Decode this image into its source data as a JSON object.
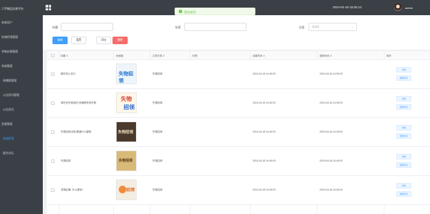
{
  "app": {
    "brand": "二手物品交易平台"
  },
  "sidebar": {
    "items": [
      {
        "label": "系统用户",
        "sub": false,
        "active": false
      },
      {
        "label": "失物招领管理",
        "sub": false,
        "active": false
      },
      {
        "label": "寻物启事管理",
        "sub": false,
        "active": false
      },
      {
        "label": "系统管理",
        "sub": false,
        "active": false
      },
      {
        "label": "轮播图管理",
        "sub": true,
        "active": false
      },
      {
        "label": "公告资讯管理",
        "sub": true,
        "active": false
      },
      {
        "label": "公告资讯",
        "sub": true,
        "active": false
      },
      {
        "label": "资源管理",
        "sub": false,
        "active": false
      },
      {
        "label": "失物招领",
        "sub": true,
        "active": true
      },
      {
        "label": "留言论坛",
        "sub": true,
        "active": false
      }
    ]
  },
  "topbar": {
    "clock": "2024-04-18 15:06:13",
    "username": "admin"
  },
  "toast": {
    "message": "提交成功!"
  },
  "filters": {
    "title_label": "标题",
    "title_placeholder": "",
    "tag_label": "标签",
    "tag_placeholder": "",
    "category_label": "分类",
    "category_placeholder": "请选择",
    "query_button": "查询",
    "reset_button": "重置",
    "add_button": "添加",
    "delete_button": "删除"
  },
  "table": {
    "headers": {
      "title": "标题 ⇕",
      "cover": "封面图",
      "category": "文章分类 ⇕",
      "tag": "标签",
      "created": "创建时间 ⇕",
      "updated": "更新时间 ⇕",
      "ops": "操作"
    },
    "rows": [
      {
        "title": "脚印寻心协力",
        "category": "失物招领",
        "tag": "",
        "created": "2024-04-18 14:45:03",
        "updated": "2024-04-18 14:59:29",
        "thumb_text": "失物招领"
      },
      {
        "title": "请在丢失物品时,快速联系您失物",
        "category": "失物招领",
        "tag": "",
        "created": "2024-04-18 14:45:03",
        "updated": "2024-04-18 14:45:03",
        "thumb_text": "失物招领"
      },
      {
        "title": "失物招领出现,寒遇什么建物",
        "category": "失物招领",
        "tag": "",
        "created": "2024-04-18 14:45:03",
        "updated": "2024-04-18 14:45:03",
        "thumb_text": "失物招领"
      },
      {
        "title": "失物招领",
        "category": "失物招领",
        "tag": "",
        "created": "2024-04-18 14:45:03",
        "updated": "2024-04-18 14:45:03",
        "thumb_text": "失物招领"
      },
      {
        "title": "寻物启事! 什么提到!",
        "category": "失物招领",
        "tag": "",
        "created": "2024-04-18 14:45:03",
        "updated": "2024-04-18 14:45:03",
        "thumb_text": "招领"
      }
    ],
    "op_detail": "详情",
    "op_comment": "查看评论"
  },
  "watermark": "CSDN @MZ_ZXD001"
}
